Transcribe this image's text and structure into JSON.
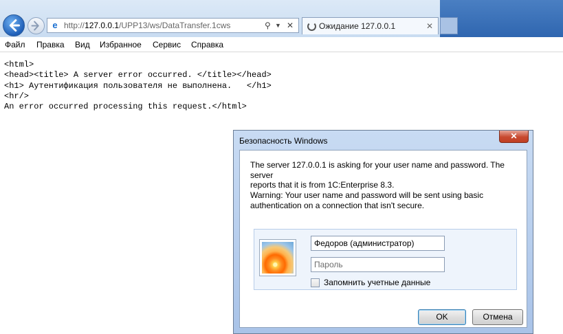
{
  "browser": {
    "address": {
      "prefix": "http://",
      "host": "127.0.0.1",
      "path": "/UPP13/ws/DataTransfer.1cws"
    },
    "tab": {
      "label": "Ожидание 127.0.0.1",
      "close": "✕"
    },
    "menu": [
      "Файл",
      "Правка",
      "Вид",
      "Избранное",
      "Сервис",
      "Справка"
    ]
  },
  "page": {
    "lines": [
      "<html>",
      "<head><title> A server error occurred. </title></head>",
      "<h1> Аутентификация пользователя не выполнена.   </h1>",
      "<hr/>",
      "An error occurred processing this request.</html>"
    ]
  },
  "dialog": {
    "title": "Безопасность Windows",
    "close": "✕",
    "message_line1": "The server 127.0.0.1 is asking for your user name and password. The server",
    "message_line2": "reports that it is from 1C:Enterprise 8.3.",
    "warning_line1": "Warning: Your user name and password will be sent using basic",
    "warning_line2": "authentication on a connection that isn't secure.",
    "username_value": "Федоров (администратор)",
    "password_placeholder": "Пароль",
    "remember_label": "Запомнить учетные данные",
    "remember_checked": false,
    "ok_label": "OK",
    "cancel_label": "Отмена"
  },
  "colors": {
    "titlebar_accent": "#2f66b0",
    "close_button": "#c84a30"
  },
  "icons": {
    "back": "back-arrow-icon",
    "forward": "forward-arrow-icon",
    "favicon": "ie-page-icon",
    "search": "search-icon",
    "dropdown": "chevron-down-icon",
    "stop": "close-icon",
    "loading": "loading-spinner-icon",
    "user": "user-picture-icon"
  }
}
